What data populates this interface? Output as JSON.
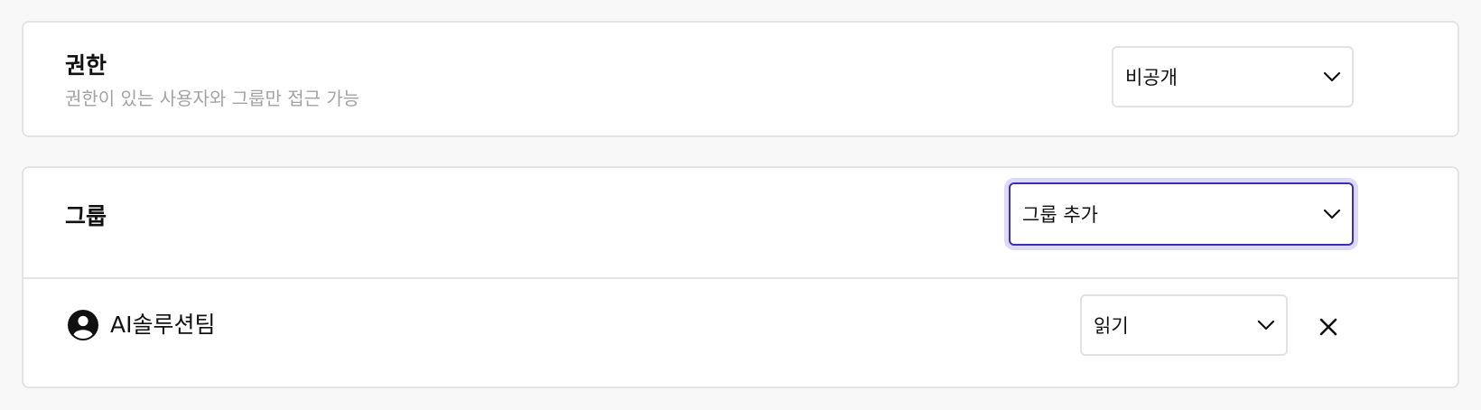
{
  "permission": {
    "title": "권한",
    "description": "권한이 있는 사용자와 그룹만 접근 가능",
    "visibility_select": {
      "value": "비공개",
      "icon": "chevron-down-icon"
    }
  },
  "groups": {
    "title": "그룹",
    "add_group_select": {
      "value": "그룹 추가",
      "icon": "chevron-down-icon",
      "state": "focused"
    },
    "members": [
      {
        "name": "AI솔루션팀",
        "icon": "user-circle-icon",
        "role_select": {
          "value": "읽기",
          "icon": "chevron-down-icon"
        },
        "remove_icon": "close-icon"
      }
    ]
  },
  "colors": {
    "background": "#f8f8f8",
    "card": "#ffffff",
    "border": "#e4e4e4",
    "focus_border": "#3b2fb8",
    "focus_ring": "#dcdaf7",
    "muted_text": "#a3a3a3"
  }
}
